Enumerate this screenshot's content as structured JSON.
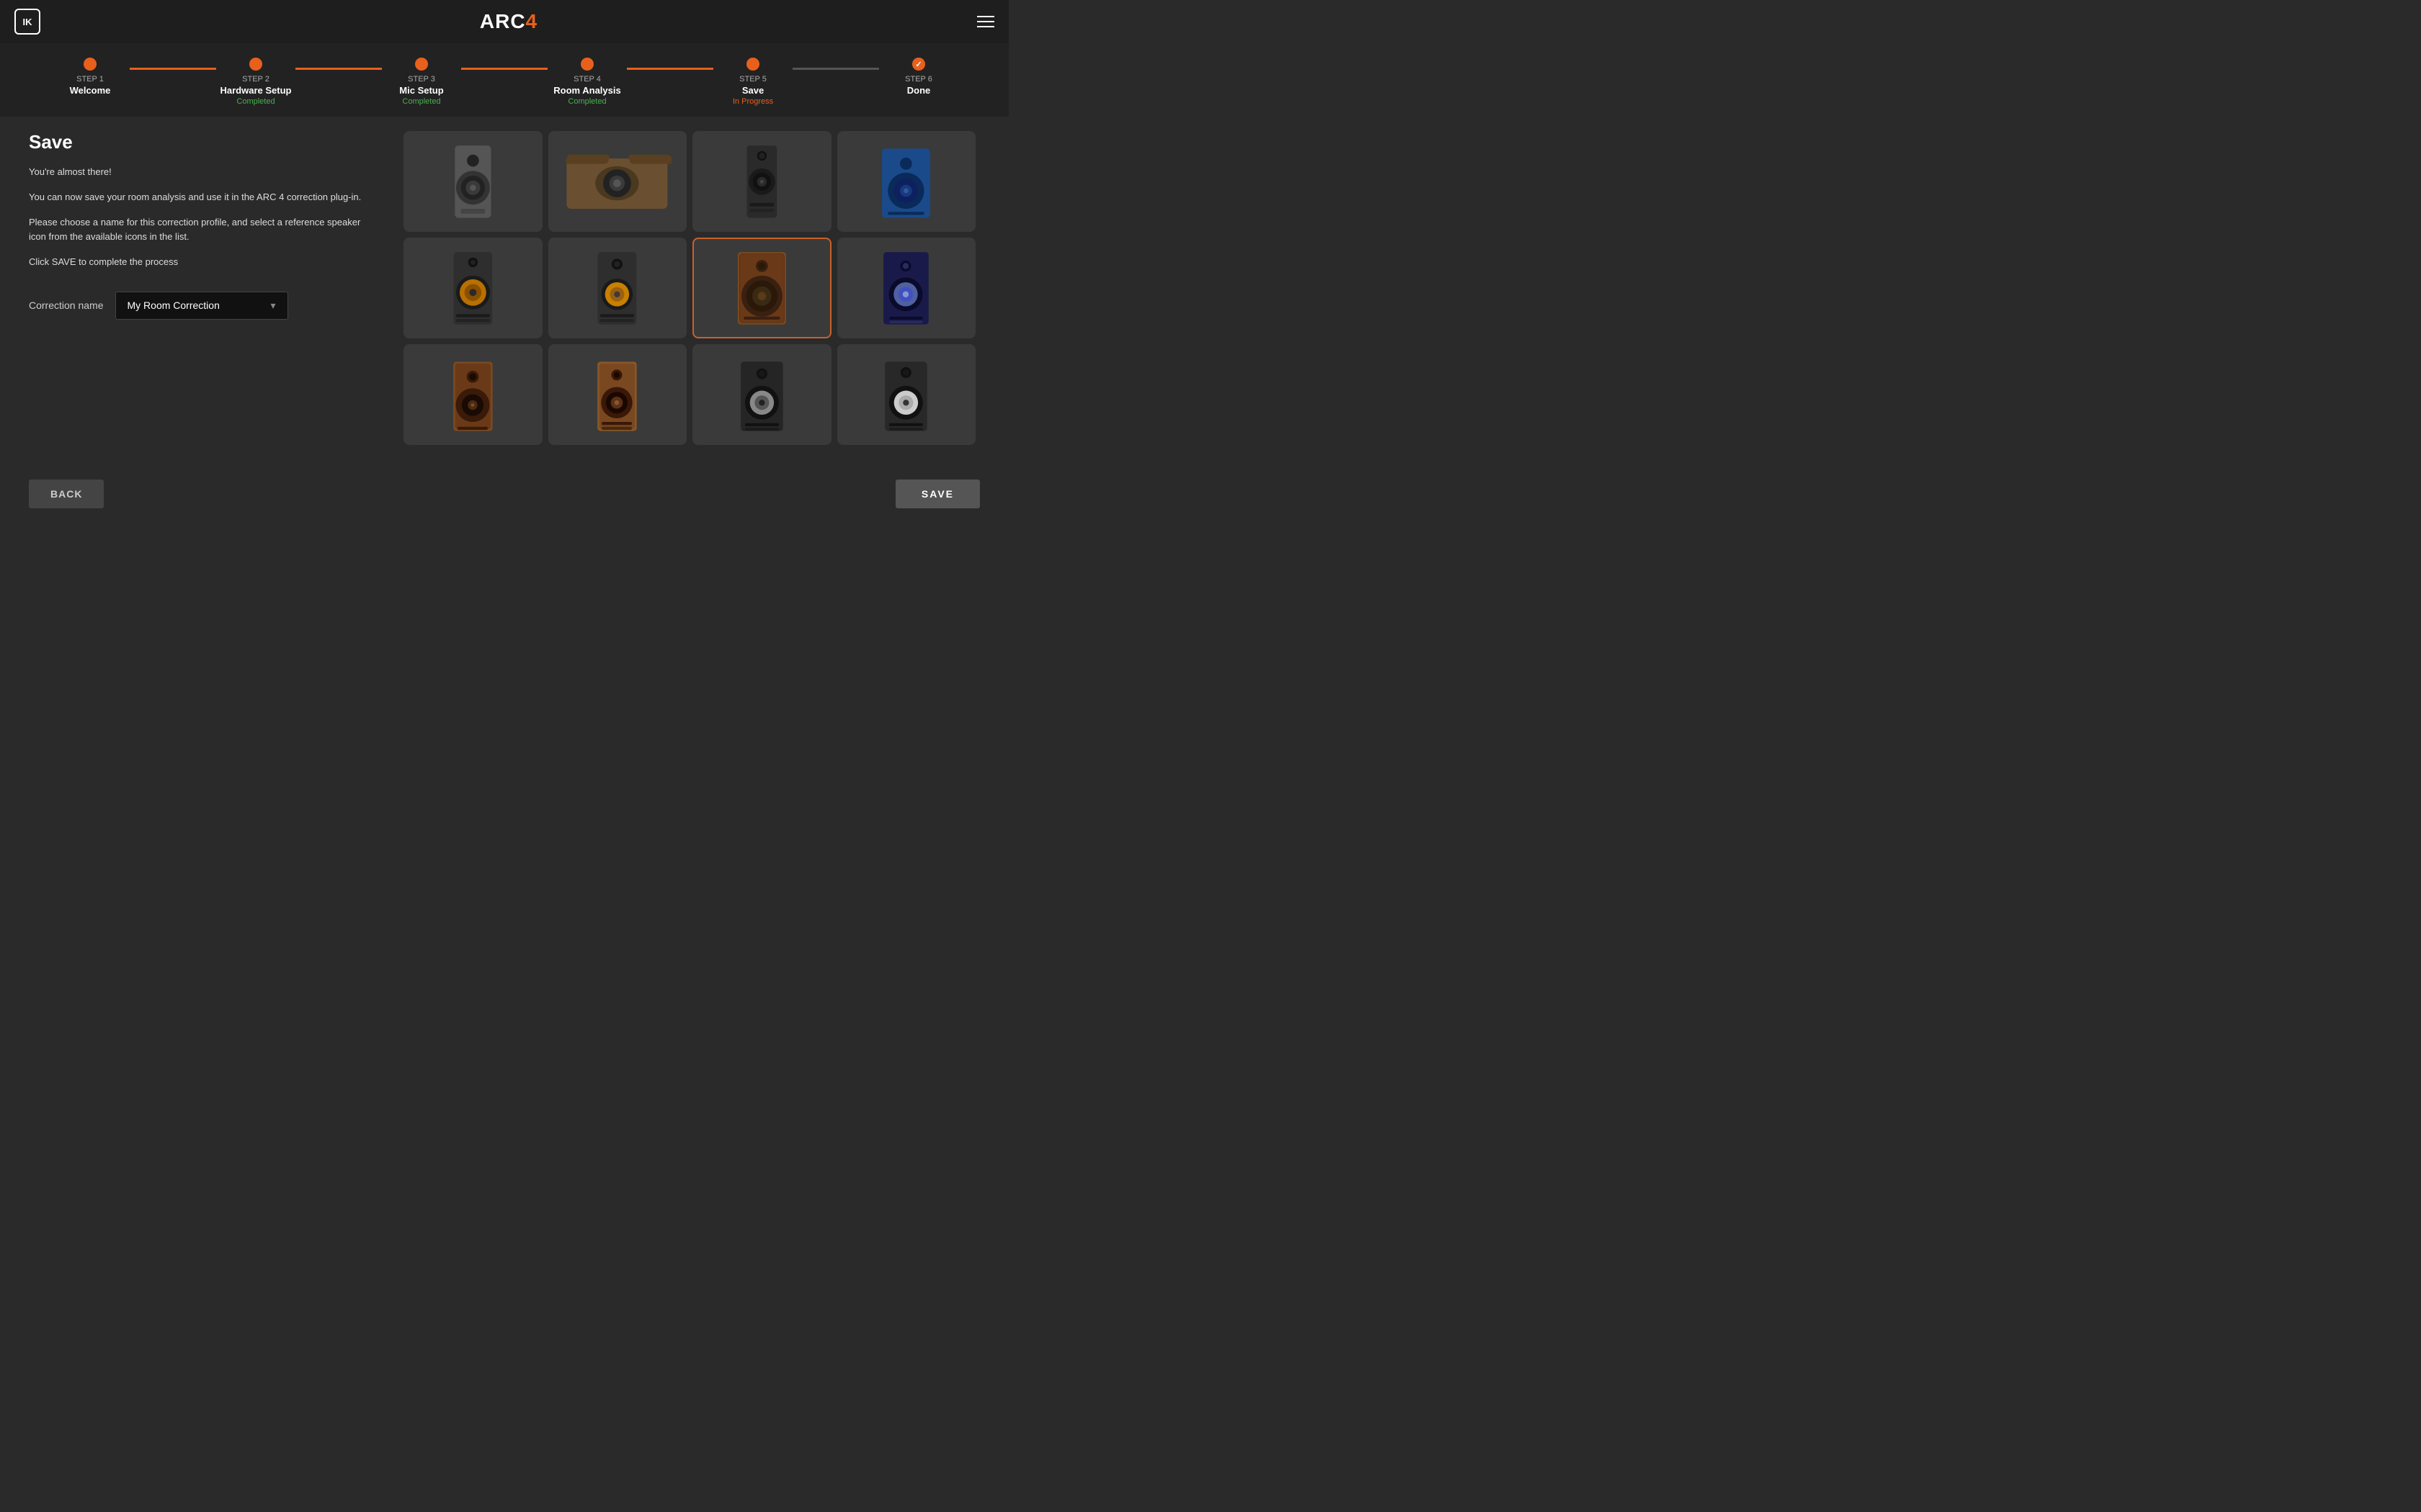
{
  "header": {
    "logo": "IK",
    "title": "ARC",
    "title_num": "4",
    "menu_label": "menu"
  },
  "steps": [
    {
      "id": "step1",
      "number": "STEP 1",
      "label": "Welcome",
      "status": "",
      "status_type": "none",
      "dot_type": "orange",
      "connector": null
    },
    {
      "id": "step2",
      "number": "STEP 2",
      "label": "Hardware Setup",
      "status": "Completed",
      "status_type": "green",
      "dot_type": "orange",
      "connector": "orange"
    },
    {
      "id": "step3",
      "number": "STEP 3",
      "label": "Mic Setup",
      "status": "Completed",
      "status_type": "green",
      "dot_type": "orange",
      "connector": "orange"
    },
    {
      "id": "step4",
      "number": "STEP 4",
      "label": "Room Analysis",
      "status": "Completed",
      "status_type": "green",
      "dot_type": "orange",
      "connector": "orange"
    },
    {
      "id": "step5",
      "number": "STEP 5",
      "label": "Save",
      "status": "In Progress",
      "status_type": "orange",
      "dot_type": "orange",
      "connector": "orange"
    },
    {
      "id": "step6",
      "number": "STEP 6",
      "label": "Done",
      "status": "",
      "status_type": "none",
      "dot_type": "grey",
      "connector": "grey"
    }
  ],
  "left": {
    "title": "Save",
    "para1": "You're almost there!",
    "para2": "You can now save your room analysis and use it in the ARC 4 correction plug-in.",
    "para3": "Please choose a name for this correction profile, and select a reference speaker icon from the available icons in the list.",
    "para4": "Click SAVE to complete the process",
    "correction_label": "Correction name",
    "correction_value": "My Room Correction"
  },
  "speakers": [
    {
      "id": "spk1",
      "selected": false,
      "color": "#5a5a5a",
      "style": "single-grey"
    },
    {
      "id": "spk2",
      "selected": false,
      "color": "#8a6a40",
      "style": "wide-brown"
    },
    {
      "id": "spk3",
      "selected": false,
      "color": "#4a4a4a",
      "style": "tall-black"
    },
    {
      "id": "spk4",
      "selected": false,
      "color": "#3060b0",
      "style": "blue-right"
    },
    {
      "id": "spk5",
      "selected": false,
      "color": "#4a4a4a",
      "style": "yellow-woofer"
    },
    {
      "id": "spk6",
      "selected": false,
      "color": "#4a4a4a",
      "style": "yellow-woofer-2"
    },
    {
      "id": "spk7",
      "selected": true,
      "color": "#8a6040",
      "style": "brown-big"
    },
    {
      "id": "spk8",
      "selected": false,
      "color": "#3a3a9a",
      "style": "blue-silver"
    },
    {
      "id": "spk9",
      "selected": false,
      "color": "#7a5030",
      "style": "wood-spk1"
    },
    {
      "id": "spk10",
      "selected": false,
      "color": "#8a6040",
      "style": "wood-spk2"
    },
    {
      "id": "spk11",
      "selected": false,
      "color": "#4a4a4a",
      "style": "black-spk1"
    },
    {
      "id": "spk12",
      "selected": false,
      "color": "#4a4a4a",
      "style": "black-spk2"
    }
  ],
  "buttons": {
    "back": "BACK",
    "save": "SAVE"
  }
}
